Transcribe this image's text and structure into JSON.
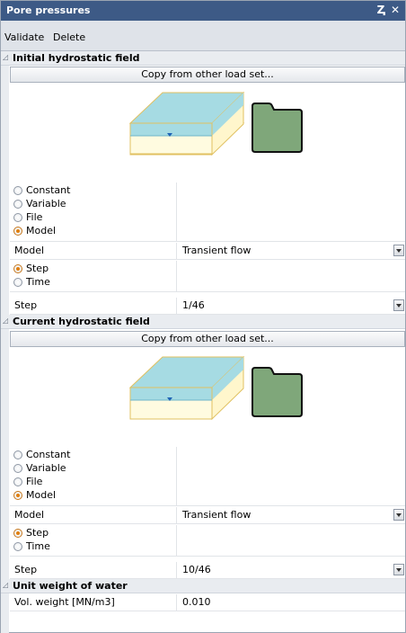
{
  "panel": {
    "title": "Pore pressures",
    "pin_glyph": "Ⱬ",
    "close_glyph": "✕"
  },
  "toolbar": {
    "validate_label": "Validate",
    "delete_label": "Delete"
  },
  "sections": {
    "initial": {
      "title": "Initial hydrostatic field",
      "copy_label": "Copy from other load set...",
      "options": [
        "Constant",
        "Variable",
        "File",
        "Model"
      ],
      "selected_option": "Model",
      "model_label": "Model",
      "model_value": "Transient flow",
      "step_time_options": [
        "Step",
        "Time"
      ],
      "selected_step_time": "Step",
      "step_label": "Step",
      "step_value": "1/46"
    },
    "current": {
      "title": "Current hydrostatic field",
      "copy_label": "Copy from other load set...",
      "options": [
        "Constant",
        "Variable",
        "File",
        "Model"
      ],
      "selected_option": "Model",
      "model_label": "Model",
      "model_value": "Transient flow",
      "step_time_options": [
        "Step",
        "Time"
      ],
      "selected_step_time": "Step",
      "step_label": "Step",
      "step_value": "10/46"
    },
    "unit_weight": {
      "title": "Unit weight of water",
      "vol_weight_label": "Vol. weight [MN/m3]",
      "vol_weight_value": "0.010"
    }
  },
  "colors": {
    "titlebar": "#3d5a86",
    "water": "#a6dbe3",
    "soil": "#fffbe0",
    "folder": "#7fa77a",
    "radio_on": "#e07f10"
  },
  "icons": [
    "pin-icon",
    "close-icon",
    "collapse-triangle-icon",
    "soil-block-icon",
    "water-table-marker-icon",
    "folder-icon",
    "dropdown-arrow-icon"
  ]
}
